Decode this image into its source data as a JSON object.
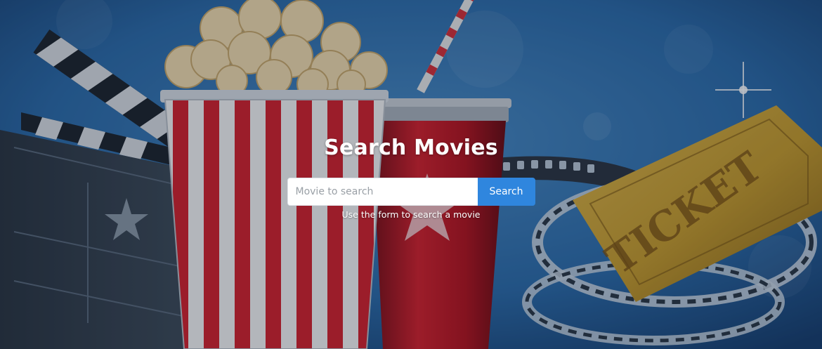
{
  "hero": {
    "title": "Search Movies",
    "help_text": "Use the form to search a movie"
  },
  "search": {
    "placeholder": "Movie to search",
    "value": "",
    "button_label": "Search"
  },
  "background": {
    "ticket_text": "TICKET",
    "icons": [
      "clapperboard-icon",
      "popcorn-icon",
      "soda-cup-icon",
      "film-reel-icon",
      "ticket-icon"
    ]
  },
  "colors": {
    "button": "#2f86de",
    "sky": "#2b6aa8",
    "popcorn_red": "#d8252f",
    "ticket_gold": "#c59a2b"
  }
}
